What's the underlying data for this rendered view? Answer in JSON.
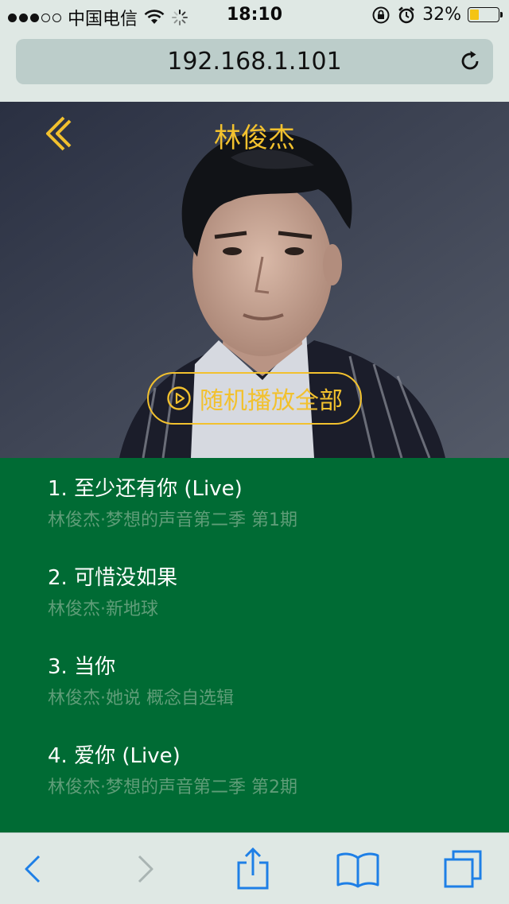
{
  "status_bar": {
    "signal_bars": [
      true,
      true,
      true,
      false,
      false
    ],
    "carrier": "中国电信",
    "time": "18:10",
    "battery_percent_label": "32%",
    "battery_level": 0.32,
    "icons": [
      "wifi-icon",
      "activity-spinner-icon",
      "orientation-lock-icon",
      "alarm-icon",
      "battery-icon"
    ]
  },
  "browser": {
    "url": "192.168.1.101"
  },
  "header": {
    "title": "林俊杰",
    "accent_color": "#f2c12e"
  },
  "play_all": {
    "label": "随机播放全部"
  },
  "songs": [
    {
      "title": "1. 至少还有你 (Live)",
      "subtitle": "林俊杰·梦想的声音第二季 第1期"
    },
    {
      "title": "2. 可惜没如果",
      "subtitle": "林俊杰·新地球"
    },
    {
      "title": "3. 当你",
      "subtitle": "林俊杰·她说 概念自选辑"
    },
    {
      "title": "4. 爱你 (Live)",
      "subtitle": "林俊杰·梦想的声音第二季 第2期"
    }
  ],
  "colors": {
    "list_background": "#006b34",
    "song_subtitle": "#5f9d78",
    "toolbar_active": "#1e7fe6",
    "toolbar_disabled": "#a9b4b2"
  }
}
